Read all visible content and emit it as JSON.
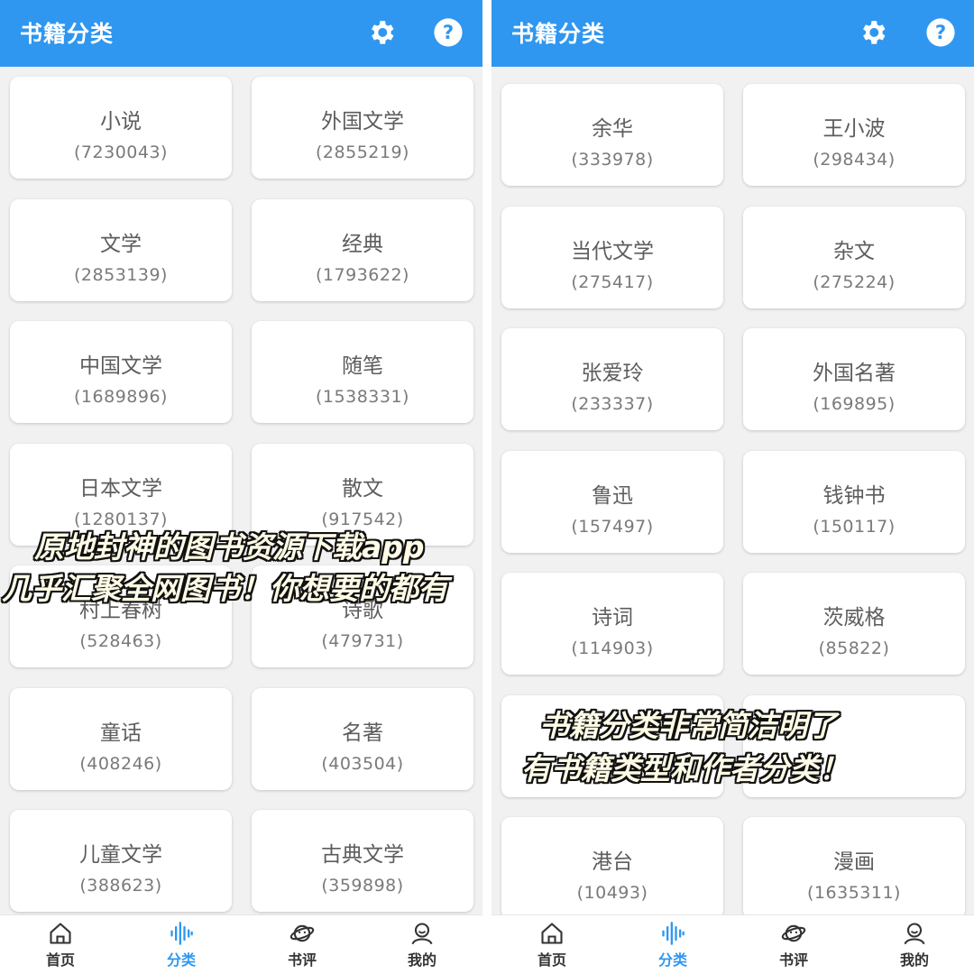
{
  "app": {
    "title": "书籍分类"
  },
  "left": {
    "categories": [
      {
        "name": "小说",
        "count": "(7230043)"
      },
      {
        "name": "外国文学",
        "count": "(2855219)"
      },
      {
        "name": "文学",
        "count": "(2853139)"
      },
      {
        "name": "经典",
        "count": "(1793622)"
      },
      {
        "name": "中国文学",
        "count": "(1689896)"
      },
      {
        "name": "随笔",
        "count": "(1538331)"
      },
      {
        "name": "日本文学",
        "count": "(1280137)"
      },
      {
        "name": "散文",
        "count": "(917542)"
      },
      {
        "name": "村上春树",
        "count": "(528463)"
      },
      {
        "name": "诗歌",
        "count": "(479731)"
      },
      {
        "name": "童话",
        "count": "(408246)"
      },
      {
        "name": "名著",
        "count": "(403504)"
      },
      {
        "name": "儿童文学",
        "count": "(388623)"
      },
      {
        "name": "古典文学",
        "count": "(359898)"
      }
    ]
  },
  "right": {
    "categories": [
      {
        "name": "余华",
        "count": "(333978)"
      },
      {
        "name": "王小波",
        "count": "(298434)"
      },
      {
        "name": "当代文学",
        "count": "(275417)"
      },
      {
        "name": "杂文",
        "count": "(275224)"
      },
      {
        "name": "张爱玲",
        "count": "(233337)"
      },
      {
        "name": "外国名著",
        "count": "(169895)"
      },
      {
        "name": "鲁迅",
        "count": "(157497)"
      },
      {
        "name": "钱钟书",
        "count": "(150117)"
      },
      {
        "name": "诗词",
        "count": "(114903)"
      },
      {
        "name": "茨威格",
        "count": "(85822)"
      },
      {
        "name": "",
        "count": ""
      },
      {
        "name": "",
        "count": ""
      },
      {
        "name": "港台",
        "count": "(10493)"
      },
      {
        "name": "漫画",
        "count": "(1635311)"
      }
    ]
  },
  "tabs": [
    {
      "label": "首页",
      "icon": "home-icon"
    },
    {
      "label": "分类",
      "icon": "waveform-icon",
      "active": true
    },
    {
      "label": "书评",
      "icon": "planet-icon"
    },
    {
      "label": "我的",
      "icon": "person-icon"
    }
  ],
  "overlay": {
    "line1": "原地封神的图书资源下载app",
    "line2": "几乎汇聚全网图书！你想要的都有",
    "line3": "书籍分类非常简洁明了",
    "line4": "有书籍类型和作者分类！"
  },
  "colors": {
    "accent": "#2f97ef",
    "background": "#f1f1f1",
    "card": "#ffffff"
  }
}
